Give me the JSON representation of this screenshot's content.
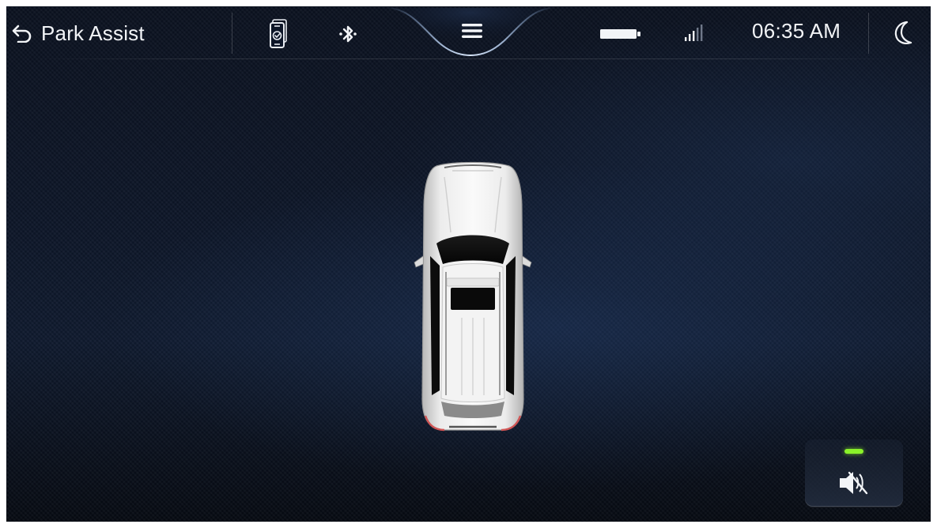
{
  "header": {
    "back_label": "Park Assist",
    "time": "06:35 AM"
  },
  "status_icons": {
    "phone": "phone-connected-icon",
    "bluetooth": "bluetooth-icon",
    "menu": "menu-icon",
    "battery": "battery-icon",
    "signal": "signal-icon",
    "night_mode": "moon-icon"
  },
  "main": {
    "vehicle": "car-top-view",
    "mute_button": "speaker-muted-icon",
    "mute_indicator_color": "#8af22a"
  },
  "colors": {
    "background": "#0d1628",
    "text": "#f2f4f7",
    "accent": "#8fb4e8"
  }
}
